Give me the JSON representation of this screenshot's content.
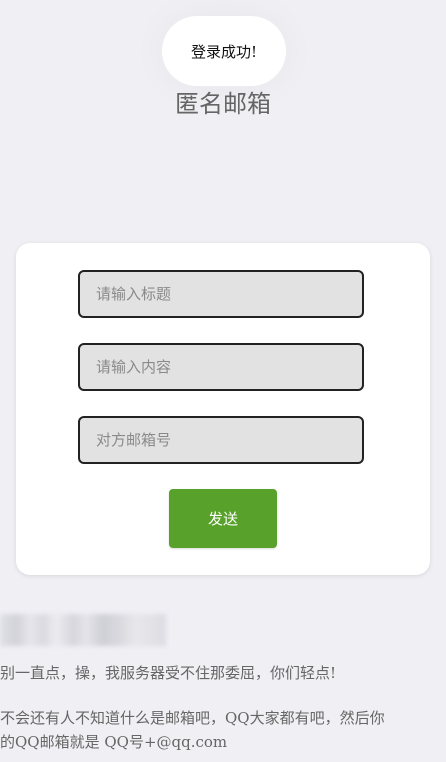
{
  "toast": {
    "message": "登录成功!"
  },
  "page_title": "匿名邮箱",
  "form": {
    "title_placeholder": "请输入标题",
    "content_placeholder": "请输入内容",
    "email_placeholder": "对方邮箱号",
    "send_label": "发送",
    "accent_color": "#58a12b"
  },
  "notes": {
    "line1": "别一直点，操，我服务器受不住那委屈，你们轻点!",
    "line2": "不会还有人不知道什么是邮箱吧，QQ大家都有吧，然后你",
    "line3": "的QQ邮箱就是 QQ号+@qq.com"
  }
}
